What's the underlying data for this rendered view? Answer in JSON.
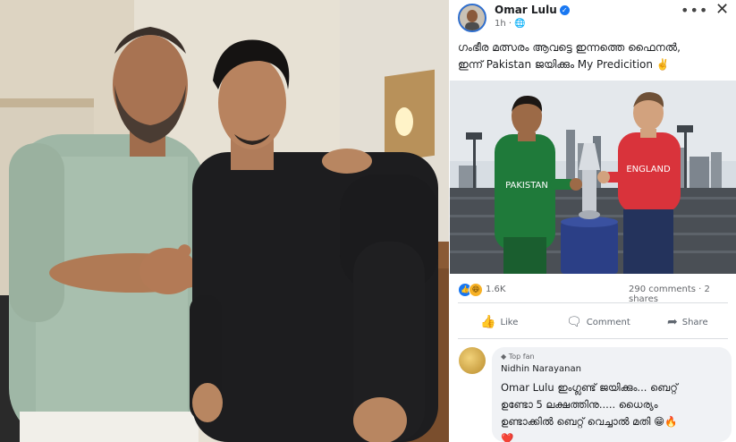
{
  "post": {
    "author": "Omar Lulu",
    "time": "1h",
    "audience_icon": "globe-icon",
    "caption_line1": "ഗംഭീര മത്സരം ആവട്ടെ ഇന്നത്തെ ഫൈനൽ,",
    "caption_line2": "ഇന്ന് Pakistan ജയിക്കും My Predicition ✌️",
    "image": {
      "jersey_left": "PAKISTAN",
      "jersey_right": "ENGLAND"
    },
    "reactions_count": "1.6K",
    "comments_shares": "290 comments · 2 shares",
    "actions": {
      "like": "Like",
      "comment": "Comment",
      "share": "Share"
    }
  },
  "comment": {
    "badge": "Top fan",
    "commenter": "Nidhin Narayanan",
    "mention": "Omar Lulu",
    "line1": " ഇംഗ്ലണ്ട് ജയിക്കും... ബെറ്റ്",
    "line2": "ഉണ്ടോ 5 ലക്ഷത്തിനു..... ധൈര്യം",
    "line3": "ഉണ്ടാക്കിൽ ബെറ്റ് വെച്ചാൽ മതി 😁🔥",
    "line4": "❤️"
  },
  "colors": {
    "accent": "#1877f2",
    "pakistan_green": "#1f7a3a",
    "england_red": "#d9333b"
  }
}
